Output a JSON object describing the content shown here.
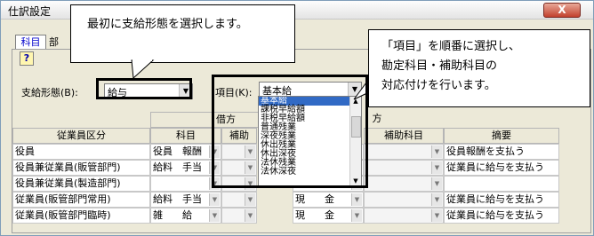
{
  "window": {
    "title": "仕訳設定",
    "close_label": "X"
  },
  "tabs": [
    {
      "label": "科目"
    },
    {
      "label": "部"
    }
  ],
  "form": {
    "pay_form_label": "支給形態(B):",
    "pay_form_value": "給与",
    "item_label": "項目(K):",
    "item_value": "基本給"
  },
  "dropdown_items": [
    "基本給",
    "課税早給額",
    "非税早給額",
    "普通残業",
    "深夜残業",
    "休出残業",
    "休出深夜",
    "法休残業",
    "法休深夜"
  ],
  "grid": {
    "header_debit": "借方",
    "header_credit_partial": "方",
    "col_employee": "従業員区分",
    "col_account": "科目",
    "col_subaccount_partial": "補助",
    "col_subaccount": "補助科目",
    "col_summary": "摘要",
    "rows": [
      {
        "employee": "役員",
        "account": "役員　報酬",
        "credit": "",
        "summary": "役員報酬を支払う"
      },
      {
        "employee": "役員兼従業員(販管部門)",
        "account": "給料　手当",
        "credit": "",
        "summary": "従業員に給与を支払う"
      },
      {
        "employee": "役員兼従業員(製造部門)",
        "account": "",
        "credit": "",
        "summary": ""
      },
      {
        "employee": "従業員(販管部門常用)",
        "account": "給料　手当",
        "credit": "現　　金",
        "summary": "従業員に給与を支払う"
      },
      {
        "employee": "従業員(販管部門臨時)",
        "account": "雑　　給",
        "credit": "現　　金",
        "summary": "従業員に給与を支払う"
      }
    ]
  },
  "callouts": {
    "top": "最初に支給形態を選択します。",
    "right_line1": "「項目」を順番に選択し、",
    "right_line2": "勘定科目・補助科目の",
    "right_line3": "対応付けを行います。"
  }
}
